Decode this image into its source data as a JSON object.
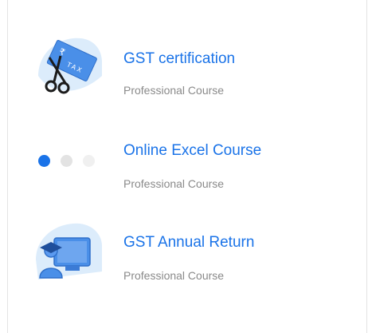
{
  "courses": [
    {
      "title": "GST certification",
      "subtitle": "Professional Course",
      "icon": "tax-scissors-icon"
    },
    {
      "title": "Online Excel Course",
      "subtitle": "Professional Course",
      "icon": "carousel-dots"
    },
    {
      "title": "GST Annual Return",
      "subtitle": "Professional Course",
      "icon": "graduate-computer-icon"
    }
  ],
  "icon_text": {
    "tax": "TAX",
    "rupee": "₹"
  },
  "carousel": {
    "active_index": 0,
    "count": 3
  },
  "colors": {
    "link": "#1a73e8",
    "subtitle": "#8a8a8a",
    "icon_bg": "#dcecfb",
    "icon_blue": "#4a8fe8",
    "dot_active": "#1a73e8",
    "dot_inactive": "#e8e8e8"
  }
}
